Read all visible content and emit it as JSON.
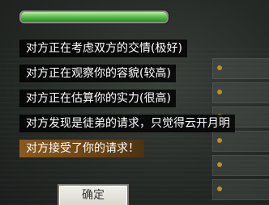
{
  "progress": {
    "fill_fraction": 1.0,
    "color": "#5fc24e"
  },
  "messages": [
    "对方正在考虑双方的交情(极好)",
    "对方正在观察你的容貌(较高)",
    "对方正在估算你的实力(很高)",
    "对方发现是徒弟的请求，只觉得云开月明",
    "对方接受了你的请求！"
  ],
  "highlight_color": "#8a5a1c",
  "confirm_label": "确定"
}
